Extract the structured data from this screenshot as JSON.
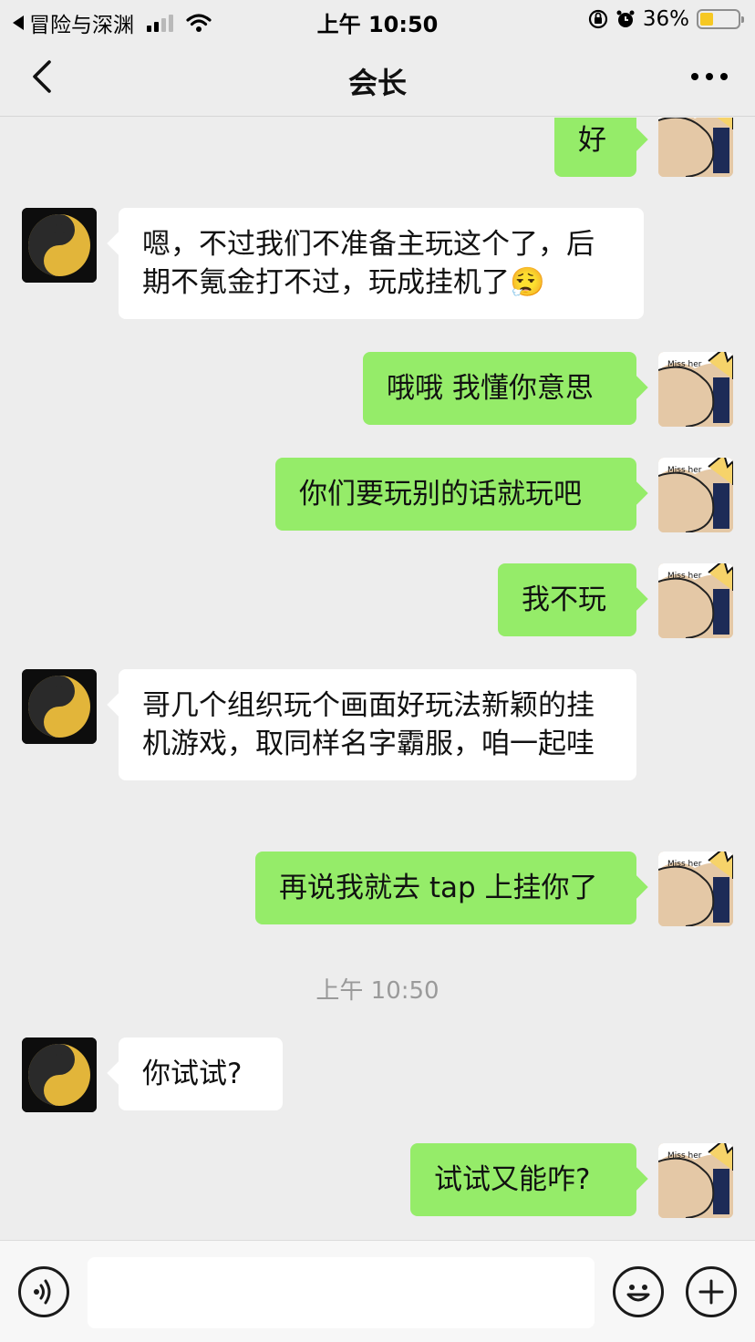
{
  "status_bar": {
    "back_app_label": "冒险与深渊",
    "time": "上午 10:50",
    "battery_percent": "36%",
    "battery_level": 0.36
  },
  "nav": {
    "title": "会长"
  },
  "messages": [
    {
      "side": "out",
      "text": "好"
    },
    {
      "side": "in",
      "text": "嗯，不过我们不准备主玩这个了，后期不氪金打不过，玩成挂机了😮‍💨"
    },
    {
      "side": "out",
      "text": "哦哦 我懂你意思"
    },
    {
      "side": "out",
      "text": "你们要玩别的话就玩吧"
    },
    {
      "side": "out",
      "text": "我不玩"
    },
    {
      "side": "in",
      "text": "哥几个组织玩个画面好玩法新颖的挂机游戏，取同样名字霸服，咱一起哇"
    },
    {
      "side": "out",
      "text": "再说我就去 tap 上挂你了"
    },
    {
      "side": "out",
      "text": "你试试?"
    },
    {
      "side": "out",
      "text": "试试又能咋?"
    }
  ],
  "timestamp": "上午 10:50",
  "avatar_me": {
    "caption": "Miss her !!!"
  },
  "colors": {
    "background": "#ededed",
    "bubble_out": "#95ec69",
    "bubble_in": "#ffffff"
  },
  "icons": {
    "back": "chevron-left-icon",
    "more": "more-dots-icon",
    "voice": "voice-icon",
    "emoji": "emoji-icon",
    "plus": "plus-icon"
  }
}
